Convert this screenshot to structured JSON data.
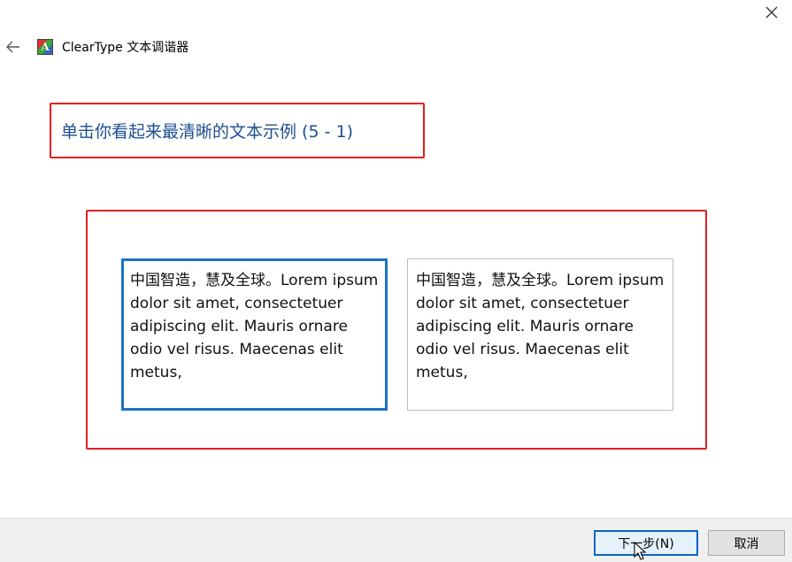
{
  "window": {
    "app_title": "ClearType 文本调谐器",
    "app_icon_letter": "A"
  },
  "instruction": "单击你看起来最清晰的文本示例 (5 - 1)",
  "samples": [
    {
      "text": "中国智造，慧及全球。Lorem ipsum dolor sit amet, consectetuer adipiscing elit. Mauris ornare odio vel risus. Maecenas elit metus,",
      "selected": true
    },
    {
      "text": "中国智造，慧及全球。Lorem ipsum dolor sit amet, consectetuer adipiscing elit. Mauris ornare odio vel risus. Maecenas elit metus,",
      "selected": false
    }
  ],
  "footer": {
    "next_label": "下一步(N)",
    "cancel_label": "取消"
  },
  "colors": {
    "accent": "#1a73c5",
    "instruction_text": "#1d4f91",
    "highlight_border": "#e02020"
  },
  "icons": {
    "close": "close-icon",
    "back": "back-arrow-icon",
    "app": "cleartype-app-icon",
    "cursor": "mouse-cursor-icon"
  }
}
